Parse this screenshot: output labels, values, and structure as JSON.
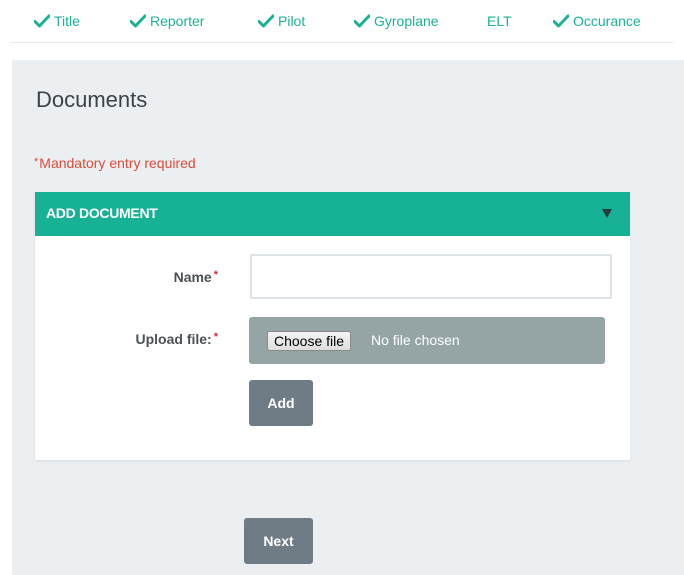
{
  "steps": [
    {
      "label": "Title",
      "done": true
    },
    {
      "label": "Reporter",
      "done": true
    },
    {
      "label": "Pilot",
      "done": true
    },
    {
      "label": "Gyroplane",
      "done": true
    },
    {
      "label": "ELT",
      "done": false
    },
    {
      "label": "Occurance",
      "done": true
    }
  ],
  "page": {
    "title": "Documents",
    "mandatory_star": "*",
    "mandatory_text": "Mandatory entry required"
  },
  "card": {
    "header": "ADD DOCUMENT",
    "name_label": "Name",
    "name_value": "",
    "upload_label": "Upload file:",
    "required_marker": "*",
    "file_button": "Choose file",
    "file_status": "No file chosen",
    "add_button": "Add"
  },
  "footer": {
    "next_button": "Next"
  },
  "colors": {
    "accent": "#1ab394",
    "header_bg": "#17b296",
    "error": "#e04b3a",
    "button_bg": "#6f7c86",
    "file_bg": "#95a4a5",
    "panel_bg": "#eceff1"
  },
  "icons": {
    "step_done": "checkmark-icon",
    "card_toggle": "caret-down-icon"
  }
}
